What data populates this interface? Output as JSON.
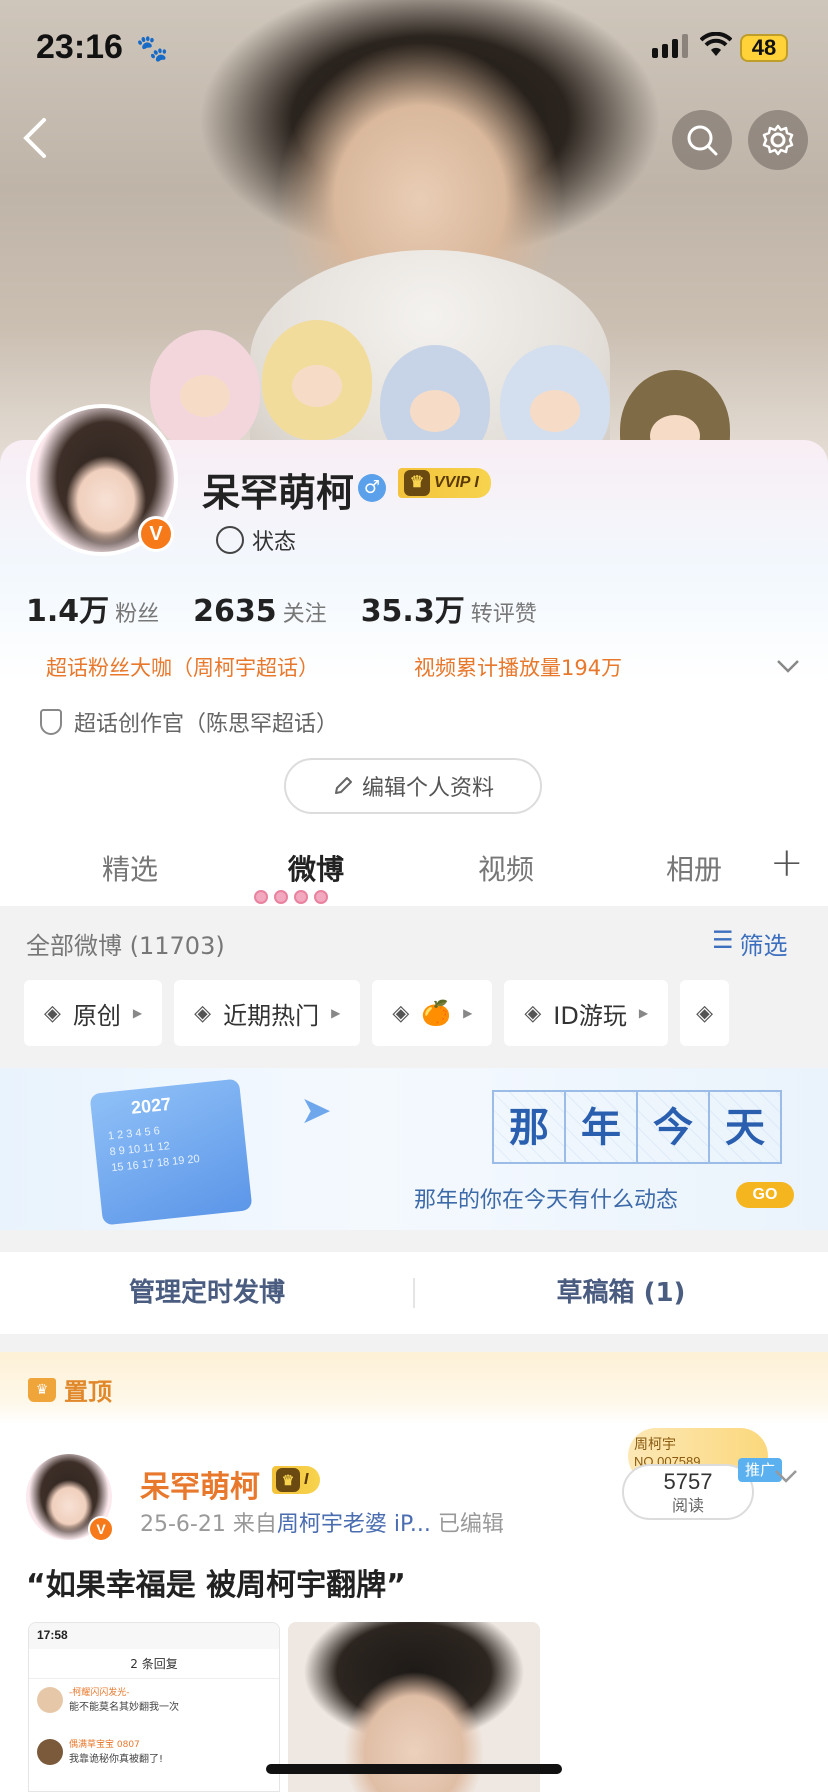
{
  "status_bar": {
    "time": "23:16",
    "battery": "48"
  },
  "profile": {
    "username": "呆罕萌柯",
    "gender_symbol": "♂",
    "vip_label": "VVIP I",
    "status_label": "状态",
    "stats": [
      {
        "value": "1.4万",
        "label": "粉丝"
      },
      {
        "value": "2635",
        "label": "关注"
      },
      {
        "value": "35.3万",
        "label": "转评赞"
      }
    ],
    "honor_left": "超话粉丝大咖（周柯宇超话）",
    "honor_right": "视频累计播放量194万",
    "creator": "超话创作官（陈思罕超话）",
    "edit_button": "编辑个人资料"
  },
  "tabs": [
    "精选",
    "微博",
    "视频",
    "相册"
  ],
  "feed": {
    "all_weibo": "全部微博 (11703)",
    "filter": "筛选",
    "chips": [
      "原创",
      "近期热门",
      "🍊",
      "ID游玩"
    ]
  },
  "banner": {
    "year": "2027",
    "title_chars": [
      "那",
      "年",
      "今",
      "天"
    ],
    "subtitle": "那年的你在今天有什么动态",
    "go": "GO"
  },
  "manage": {
    "scheduled": "管理定时发博",
    "drafts": "草稿箱 (1)"
  },
  "pinned": {
    "label": "置顶",
    "author": "呆罕萌柯",
    "level": "I",
    "date": "25-6-21",
    "from_prefix": "来自",
    "source": "周柯宇老婆 iP...",
    "edited": "已编辑",
    "promo_name": "周柯宇",
    "promo_no": "NO.007589",
    "promo_tag": "推广",
    "reads_count": "5757",
    "reads_label": "阅读",
    "text": "“如果幸福是 被周柯宇翻牌”",
    "thumb1": {
      "time": "17:58",
      "header": "2 条回复",
      "comment1_name": "-柯耀闪闪发光-",
      "comment1_text": "能不能莫名其妙翻我一次",
      "comment2_name": "偶满草宝宝 0807",
      "comment2_text": "我靠诡秘你真被翻了!"
    }
  },
  "colors": {
    "accent_orange": "#e8782c",
    "link_blue": "#3d6fbf",
    "vip_gold": "#f4c33b"
  }
}
